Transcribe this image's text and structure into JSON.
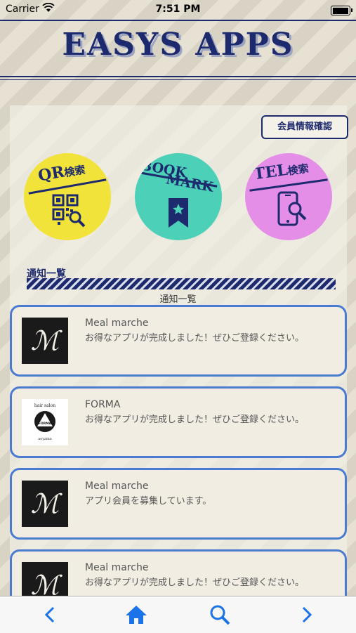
{
  "status_bar": {
    "carrier": "Carrier",
    "time": "7:51 PM"
  },
  "header": {
    "title": "EASYS APPS"
  },
  "member_button": {
    "label": "会員情報確認"
  },
  "menu": {
    "qr": {
      "label": "QR",
      "sub": "検索",
      "color": "#f2e33a"
    },
    "bookmark": {
      "line1": "BOOK",
      "line2": "MARK",
      "color": "#4cd0b8"
    },
    "tel": {
      "label": "TEL",
      "sub": "検索",
      "color": "#e58ee8"
    }
  },
  "notifications": {
    "heading": "通知一覧",
    "caption": "通知一覧",
    "items": [
      {
        "title": "Meal marche",
        "message": "お得なアプリが完成しました！ぜひご登録ください。",
        "logo": "meal-marche-logo"
      },
      {
        "title": "FORMA",
        "message": "お得なアプリが完成しました！ぜひご登録ください。",
        "logo": "forma-logo"
      },
      {
        "title": "Meal marche",
        "message": "アプリ会員を募集しています。",
        "logo": "meal-marche-logo"
      },
      {
        "title": "Meal marche",
        "message": "お得なアプリが完成しました！ぜひご登録ください。",
        "logo": "meal-marche-logo"
      }
    ]
  },
  "forma_logo": {
    "top": "hair salon",
    "name": "FORMA",
    "bottom": "aoyama"
  },
  "toolbar": {
    "back_icon": "chevron-left-icon",
    "home_icon": "home-icon",
    "search_icon": "search-icon",
    "forward_icon": "chevron-right-icon"
  },
  "colors": {
    "navy": "#1d2a6e",
    "card_border": "#4a7bd0",
    "toolbar_icon": "#1a73e8"
  }
}
